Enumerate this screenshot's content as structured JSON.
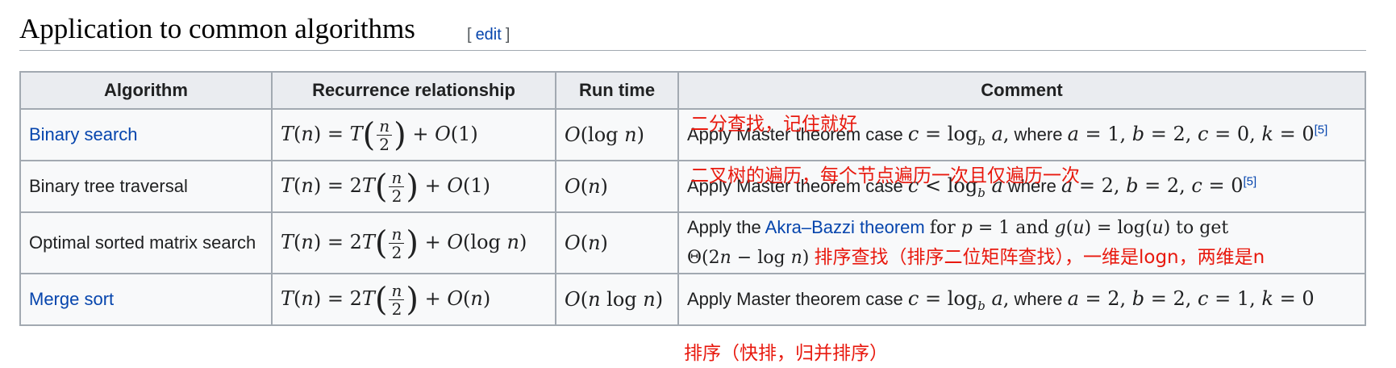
{
  "section": {
    "title": "Application to common algorithms",
    "edit_open": "[",
    "edit_label": "edit",
    "edit_close": "]"
  },
  "table": {
    "headers": [
      "Algorithm",
      "Recurrence relationship",
      "Run time",
      "Comment"
    ],
    "rows": [
      {
        "algorithm": "Binary search",
        "algorithm_is_link": true,
        "recurrence": "T(n) = T(n/2) + O(1)",
        "run_time": "O(log n)",
        "comment_prefix": "Apply Master theorem case",
        "comment_math": "c = log_b a, where a = 1, b = 2, c = 0, k = 0",
        "ref": "[5]",
        "note": "二分查找，记住就好"
      },
      {
        "algorithm": "Binary tree traversal",
        "algorithm_is_link": false,
        "recurrence": "T(n) = 2T(n/2) + O(1)",
        "run_time": "O(n)",
        "comment_prefix": "Apply Master theorem case",
        "comment_math": "c < log_b a where a = 2, b = 2, c = 0",
        "ref": "[5]",
        "note": "二叉树的遍历，每个节点遍历一次且仅遍历一次"
      },
      {
        "algorithm": "Optimal sorted matrix search",
        "algorithm_is_link": false,
        "recurrence": "T(n) = 2T(n/2) + O(log n)",
        "run_time": "O(n)",
        "comment_prefix": "Apply the",
        "comment_link": "Akra–Bazzi theorem",
        "comment_mid": "for p = 1 and g(u) = log(u) to get",
        "comment_math": "Θ(2n − log n)",
        "note": "排序查找（排序二位矩阵查找），一维是logn，两维是n"
      },
      {
        "algorithm": "Merge sort",
        "algorithm_is_link": true,
        "recurrence": "T(n) = 2T(n/2) + O(n)",
        "run_time": "O(n log n)",
        "comment_prefix": "Apply Master theorem case",
        "comment_math": "c = log_b a, where a = 2, b = 2, c = 1, k = 0"
      }
    ],
    "footer_note": "排序（快排，归并排序）"
  },
  "colors": {
    "link": "#0645ad",
    "annotation": "#e8190e",
    "header_bg": "#eaecf0",
    "border": "#a2a9b1"
  }
}
